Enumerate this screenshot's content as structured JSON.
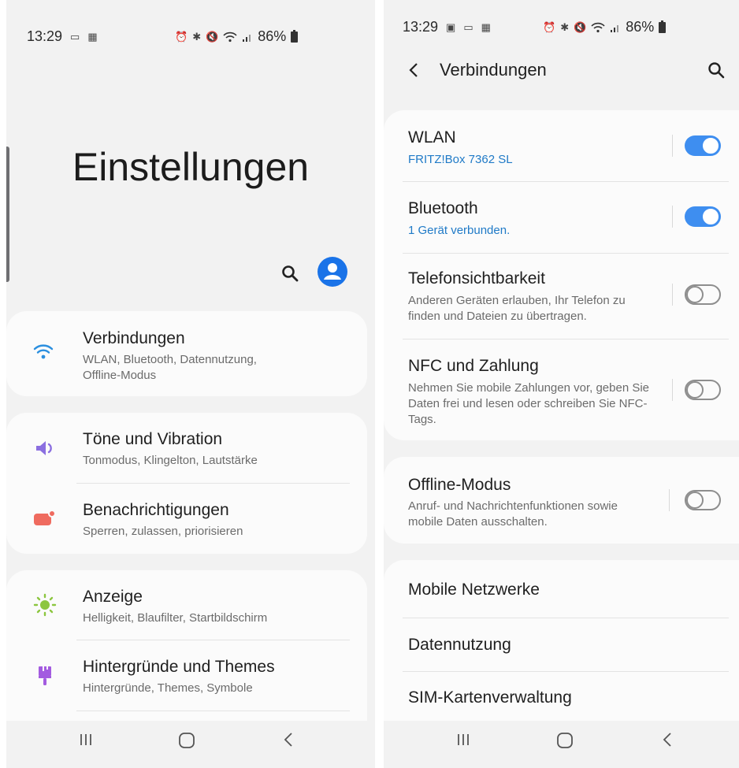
{
  "left": {
    "status": {
      "time": "13:29",
      "battery_percent": "86%"
    },
    "page_title": "Einstellungen",
    "groups": [
      {
        "items": [
          {
            "title": "Verbindungen",
            "subtitle": "WLAN, Bluetooth, Datennutzung, Offline-Modus",
            "icon": "wifi-icon",
            "color": "#2b8fdf"
          }
        ]
      },
      {
        "items": [
          {
            "title": "Töne und Vibration",
            "subtitle": "Tonmodus, Klingelton, Lautstärke",
            "icon": "speaker-icon",
            "color": "#8b6fe0"
          },
          {
            "title": "Benachrichtigungen",
            "subtitle": "Sperren, zulassen, priorisieren",
            "icon": "notification-icon",
            "color": "#ef6b5f"
          }
        ]
      },
      {
        "items": [
          {
            "title": "Anzeige",
            "subtitle": "Helligkeit, Blaufilter, Startbildschirm",
            "icon": "sun-icon",
            "color": "#8cc63f"
          },
          {
            "title": "Hintergründe und Themes",
            "subtitle": "Hintergründe, Themes, Symbole",
            "icon": "paintbrush-icon",
            "color": "#a35be0"
          }
        ]
      }
    ]
  },
  "right": {
    "status": {
      "time": "13:29",
      "battery_percent": "86%"
    },
    "header_title": "Verbindungen",
    "group1": [
      {
        "title": "WLAN",
        "subtitle": "FRITZ!Box 7362 SL",
        "toggle_on": true
      },
      {
        "title": "Bluetooth",
        "subtitle": "1 Gerät verbunden.",
        "toggle_on": true
      },
      {
        "title": "Telefonsichtbarkeit",
        "subtitle": "Anderen Geräten erlauben, Ihr Telefon zu finden und Dateien zu übertragen.",
        "toggle_on": false
      },
      {
        "title": "NFC und Zahlung",
        "subtitle": "Nehmen Sie mobile Zahlungen vor, geben Sie Daten frei und lesen oder schreiben Sie NFC-Tags.",
        "toggle_on": false
      }
    ],
    "group2": [
      {
        "title": "Offline-Modus",
        "subtitle": "Anruf- und Nachrichtenfunktionen sowie mobile Daten ausschalten.",
        "toggle_on": false
      }
    ],
    "group3": [
      {
        "title": "Mobile Netzwerke"
      },
      {
        "title": "Datennutzung"
      },
      {
        "title": "SIM-Kartenverwaltung"
      }
    ]
  },
  "colors": {
    "accent": "#3e8ef0",
    "avatar": "#1a73e8",
    "link_blue": "#1f7ac7"
  }
}
